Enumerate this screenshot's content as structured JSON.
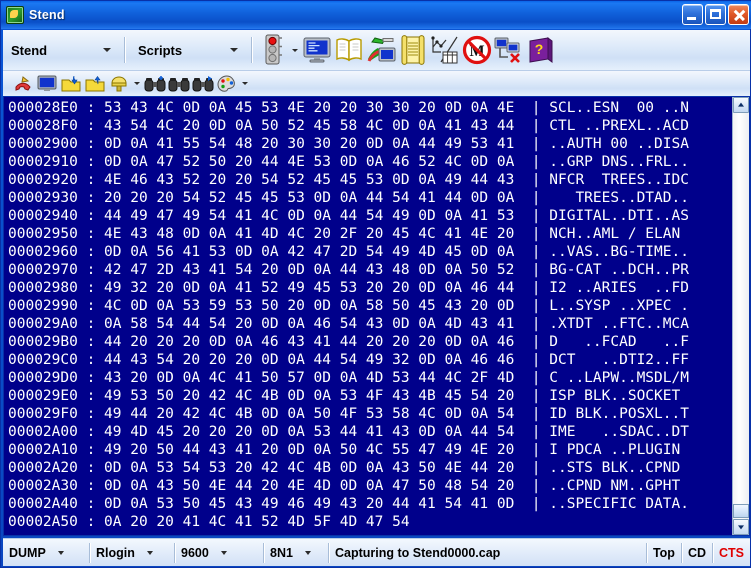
{
  "window": {
    "title": "Stend",
    "icon": "app-icon",
    "buttons": {
      "minimize": "minimize",
      "maximize": "maximize",
      "close": "close"
    }
  },
  "toolbar_main": {
    "combo_stend": {
      "label": "Stend"
    },
    "combo_scripts": {
      "label": "Scripts"
    },
    "icons": [
      {
        "name": "traffic-light-icon",
        "has_dropdown": true
      },
      {
        "name": "terminal-monitor-icon",
        "has_dropdown": false
      },
      {
        "name": "open-book-icon",
        "has_dropdown": false
      },
      {
        "name": "screwdriver-monitor-icon",
        "has_dropdown": false
      },
      {
        "name": "scroll-document-icon",
        "has_dropdown": false
      },
      {
        "name": "graph-table-icon",
        "has_dropdown": false
      },
      {
        "name": "no-modem-icon",
        "has_dropdown": false
      },
      {
        "name": "disconnect-network-icon",
        "has_dropdown": false
      },
      {
        "name": "help-book-icon",
        "has_dropdown": false
      }
    ]
  },
  "toolbar_secondary": {
    "icons": [
      {
        "name": "phone-hangup-icon",
        "has_dropdown": false
      },
      {
        "name": "monitor-icon",
        "has_dropdown": false
      },
      {
        "name": "folder-send-icon",
        "has_dropdown": false
      },
      {
        "name": "folder-upload-icon",
        "has_dropdown": false
      },
      {
        "name": "capture-filter-icon",
        "has_dropdown": true
      },
      {
        "name": "binoculars-find-icon",
        "has_dropdown": false
      },
      {
        "name": "binoculars-icon",
        "has_dropdown": false
      },
      {
        "name": "binoculars-next-icon",
        "has_dropdown": false
      },
      {
        "name": "color-palette-icon",
        "has_dropdown": true
      }
    ]
  },
  "hexview": {
    "separator": "|",
    "colors": {
      "background": "#00008b",
      "text": "#ffffff"
    },
    "rows": [
      {
        "address": "000028E0",
        "bytes": "53 43 4C 0D 0A 45 53 4E 20 20 30 30 20 0D 0A 4E",
        "ascii": "SCL..ESN  00 ..N"
      },
      {
        "address": "000028F0",
        "bytes": "43 54 4C 20 0D 0A 50 52 45 58 4C 0D 0A 41 43 44",
        "ascii": "CTL ..PREXL..ACD"
      },
      {
        "address": "00002900",
        "bytes": "0D 0A 41 55 54 48 20 30 30 20 0D 0A 44 49 53 41",
        "ascii": "..AUTH 00 ..DISA"
      },
      {
        "address": "00002910",
        "bytes": "0D 0A 47 52 50 20 44 4E 53 0D 0A 46 52 4C 0D 0A",
        "ascii": "..GRP DNS..FRL.."
      },
      {
        "address": "00002920",
        "bytes": "4E 46 43 52 20 20 54 52 45 45 53 0D 0A 49 44 43",
        "ascii": "NFCR  TREES..IDC"
      },
      {
        "address": "00002930",
        "bytes": "20 20 20 54 52 45 45 53 0D 0A 44 54 41 44 0D 0A",
        "ascii": "   TREES..DTAD.."
      },
      {
        "address": "00002940",
        "bytes": "44 49 47 49 54 41 4C 0D 0A 44 54 49 0D 0A 41 53",
        "ascii": "DIGITAL..DTI..AS"
      },
      {
        "address": "00002950",
        "bytes": "4E 43 48 0D 0A 41 4D 4C 20 2F 20 45 4C 41 4E 20",
        "ascii": "NCH..AML / ELAN "
      },
      {
        "address": "00002960",
        "bytes": "0D 0A 56 41 53 0D 0A 42 47 2D 54 49 4D 45 0D 0A",
        "ascii": "..VAS..BG-TIME.."
      },
      {
        "address": "00002970",
        "bytes": "42 47 2D 43 41 54 20 0D 0A 44 43 48 0D 0A 50 52",
        "ascii": "BG-CAT ..DCH..PR"
      },
      {
        "address": "00002980",
        "bytes": "49 32 20 0D 0A 41 52 49 45 53 20 20 0D 0A 46 44",
        "ascii": "I2 ..ARIES  ..FD"
      },
      {
        "address": "00002990",
        "bytes": "4C 0D 0A 53 59 53 50 20 0D 0A 58 50 45 43 20 0D",
        "ascii": "L..SYSP ..XPEC ."
      },
      {
        "address": "000029A0",
        "bytes": "0A 58 54 44 54 20 0D 0A 46 54 43 0D 0A 4D 43 41",
        "ascii": ".XTDT ..FTC..MCA"
      },
      {
        "address": "000029B0",
        "bytes": "44 20 20 20 0D 0A 46 43 41 44 20 20 20 0D 0A 46",
        "ascii": "D   ..FCAD   ..F"
      },
      {
        "address": "000029C0",
        "bytes": "44 43 54 20 20 20 0D 0A 44 54 49 32 0D 0A 46 46",
        "ascii": "DCT   ..DTI2..FF"
      },
      {
        "address": "000029D0",
        "bytes": "43 20 0D 0A 4C 41 50 57 0D 0A 4D 53 44 4C 2F 4D",
        "ascii": "C ..LAPW..MSDL/M"
      },
      {
        "address": "000029E0",
        "bytes": "49 53 50 20 42 4C 4B 0D 0A 53 4F 43 4B 45 54 20",
        "ascii": "ISP BLK..SOCKET "
      },
      {
        "address": "000029F0",
        "bytes": "49 44 20 42 4C 4B 0D 0A 50 4F 53 58 4C 0D 0A 54",
        "ascii": "ID BLK..POSXL..T"
      },
      {
        "address": "00002A00",
        "bytes": "49 4D 45 20 20 20 0D 0A 53 44 41 43 0D 0A 44 54",
        "ascii": "IME   ..SDAC..DT"
      },
      {
        "address": "00002A10",
        "bytes": "49 20 50 44 43 41 20 0D 0A 50 4C 55 47 49 4E 20",
        "ascii": "I PDCA ..PLUGIN "
      },
      {
        "address": "00002A20",
        "bytes": "0D 0A 53 54 53 20 42 4C 4B 0D 0A 43 50 4E 44 20",
        "ascii": "..STS BLK..CPND "
      },
      {
        "address": "00002A30",
        "bytes": "0D 0A 43 50 4E 44 20 4E 4D 0D 0A 47 50 48 54 20",
        "ascii": "..CPND NM..GPHT "
      },
      {
        "address": "00002A40",
        "bytes": "0D 0A 53 50 45 43 49 46 49 43 20 44 41 54 41 0D",
        "ascii": "..SPECIFIC DATA."
      },
      {
        "address": "00002A50",
        "bytes": "0A 20 20 41 4C 41 52 4D 5F 4D 47 54",
        "ascii": ""
      }
    ]
  },
  "scrollbar": {
    "up_arrow": "scroll-up",
    "down_arrow": "scroll-down",
    "thumb": "scroll-thumb"
  },
  "statusbar": {
    "mode": "DUMP",
    "protocol": "Rlogin",
    "baud": "9600",
    "framing": "8N1",
    "capture": "Capturing to Stend0000.cap",
    "position": "Top",
    "cd": "CD",
    "cts": "CTS",
    "cts_color": "#e00000"
  }
}
